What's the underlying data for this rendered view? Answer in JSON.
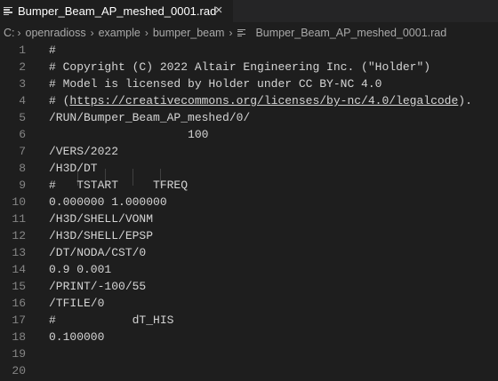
{
  "tab": {
    "title": "Bumper_Beam_AP_meshed_0001.rad",
    "close_glyph": "×",
    "icon": "lines-file-icon"
  },
  "breadcrumb": {
    "items": [
      "C:",
      "openradioss",
      "example",
      "bumper_beam"
    ],
    "file": "Bumper_Beam_AP_meshed_0001.rad",
    "separator": "›"
  },
  "editor": {
    "lines": [
      {
        "n": "1",
        "text": "#"
      },
      {
        "n": "2",
        "text": "# Copyright (C) 2022 Altair Engineering Inc. (\"Holder\")"
      },
      {
        "n": "3",
        "text": "# Model is licensed by Holder under CC BY-NC 4.0"
      },
      {
        "n": "4",
        "pre": "# (",
        "link": "https://creativecommons.org/licenses/by-nc/4.0/legalcode",
        "post": ")."
      },
      {
        "n": "5",
        "text": "/RUN/Bumper_Beam_AP_meshed/0/"
      },
      {
        "n": "6",
        "text": "                    100"
      },
      {
        "n": "7",
        "text": "/VERS/2022"
      },
      {
        "n": "8",
        "text": "/H3D/DT"
      },
      {
        "n": "9",
        "text": "#   TSTART     TFREQ"
      },
      {
        "n": "10",
        "text": "0.000000 1.000000"
      },
      {
        "n": "11",
        "text": "/H3D/SHELL/VONM"
      },
      {
        "n": "12",
        "text": "/H3D/SHELL/EPSP"
      },
      {
        "n": "13",
        "text": "/DT/NODA/CST/0"
      },
      {
        "n": "14",
        "text": "0.9 0.001"
      },
      {
        "n": "15",
        "text": "/PRINT/-100/55"
      },
      {
        "n": "16",
        "text": "/TFILE/0"
      },
      {
        "n": "17",
        "text": "#           dT_HIS"
      },
      {
        "n": "18",
        "text": "0.100000"
      },
      {
        "n": "19",
        "text": ""
      },
      {
        "n": "20",
        "text": ""
      }
    ]
  }
}
